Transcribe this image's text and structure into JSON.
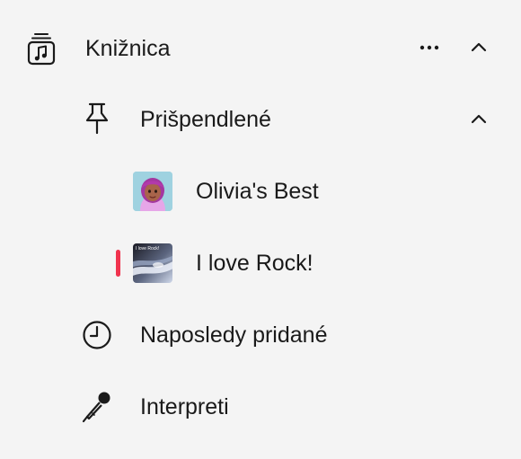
{
  "colors": {
    "background": "#f4f4f4",
    "text": "#1a1a1a",
    "now_playing_accent": "#f0334e"
  },
  "library": {
    "label": "Knižnica",
    "icon": "music-library-icon",
    "more_icon": "ellipsis-icon",
    "collapse_icon": "chevron-up-icon"
  },
  "pinned": {
    "label": "Prišpendlené",
    "icon": "pushpin-icon",
    "collapse_icon": "chevron-up-icon",
    "items": [
      {
        "label": "Olivia's Best",
        "artwork": "memoji-avatar-artwork",
        "now_playing": false
      },
      {
        "label": "I love Rock!",
        "artwork_text": "I love Rock!",
        "artwork": "rock-playlist-artwork",
        "now_playing": true
      }
    ]
  },
  "nav": [
    {
      "label": "Naposledy pridané",
      "icon": "clock-icon"
    },
    {
      "label": "Interpreti",
      "icon": "microphone-icon"
    }
  ]
}
